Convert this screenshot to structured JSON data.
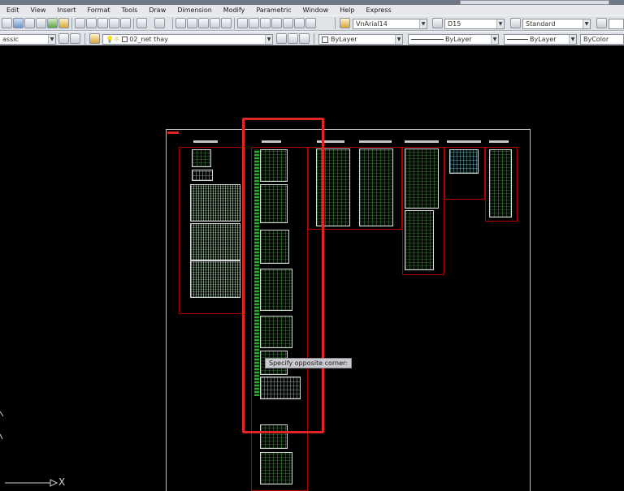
{
  "menu": [
    "Edit",
    "View",
    "Insert",
    "Format",
    "Tools",
    "Draw",
    "Dimension",
    "Modify",
    "Parametric",
    "Window",
    "Help",
    "Express"
  ],
  "toolbar": {
    "text_style": "VnArial14",
    "dim_style": "D15",
    "table_style": "Standard",
    "workspace": "assic",
    "layer": "02_net thay",
    "color": "ByLayer",
    "linetype": "ByLayer",
    "lineweight": "ByLayer",
    "plotstyle": "ByColor"
  },
  "canvas": {
    "tooltip": "Specify opposite corner:",
    "ucs_x_label": "X",
    "highlight_color": "#e02525",
    "background": "#000000"
  }
}
